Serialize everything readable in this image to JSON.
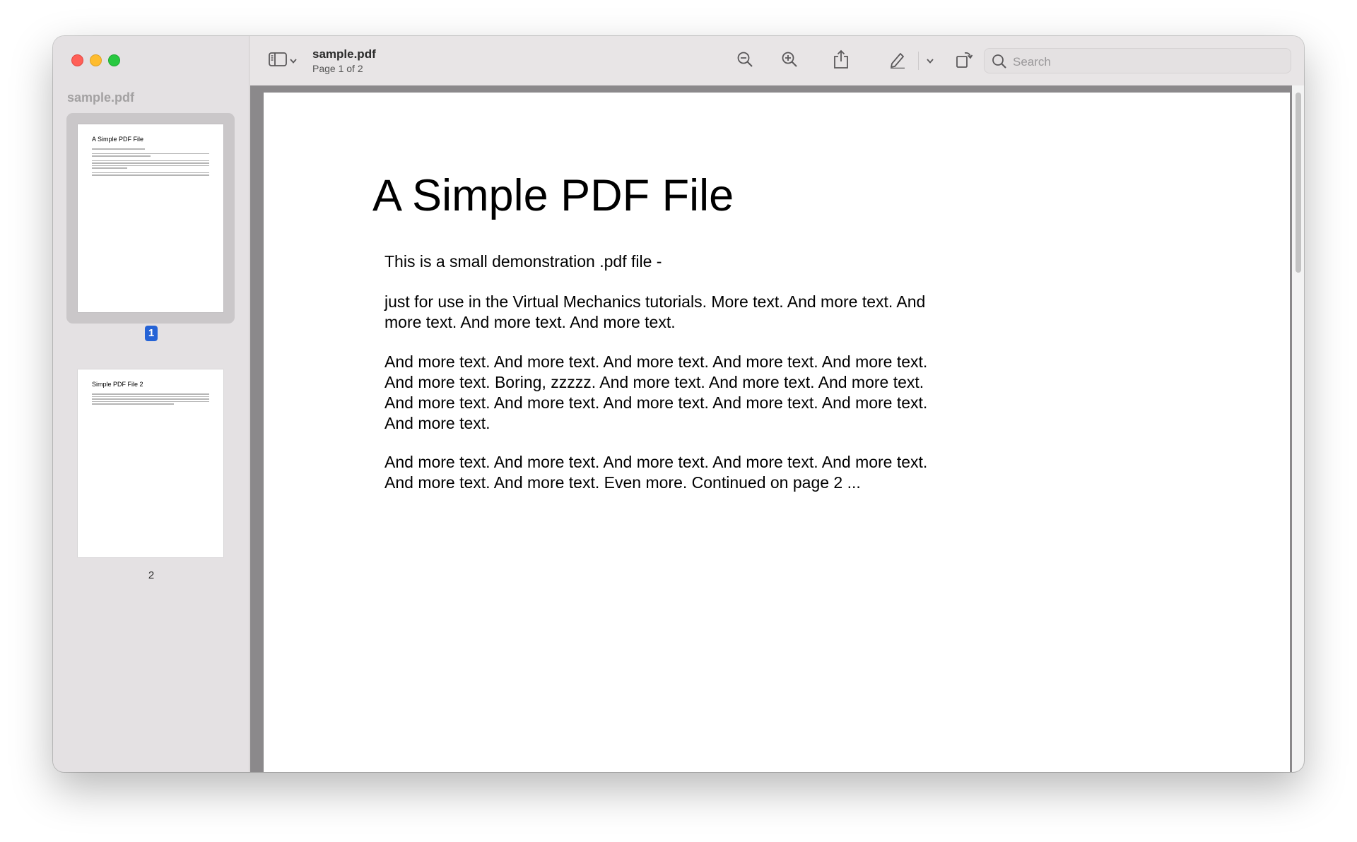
{
  "window": {
    "title": "sample.pdf",
    "subtitle": "Page 1 of 2"
  },
  "sidebar": {
    "title": "sample.pdf",
    "thumbnails": [
      {
        "page_label": "1",
        "heading": "A Simple PDF File",
        "selected": true
      },
      {
        "page_label": "2",
        "heading": "Simple PDF File 2",
        "selected": false
      }
    ]
  },
  "toolbar": {
    "icons": [
      "sidebar-toggle-icon",
      "chevron-down-icon",
      "zoom-out-icon",
      "zoom-in-icon",
      "share-icon",
      "markup-pen-icon",
      "chevron-down-icon",
      "rotate-icon",
      "annotate-icon"
    ],
    "search_placeholder": "Search"
  },
  "document": {
    "title": "A Simple PDF File",
    "paragraphs": [
      "This is a small demonstration .pdf file -",
      "just for use in the Virtual Mechanics tutorials. More text. And more text. And more text. And more text. And more text.",
      "And more text. And more text. And more text. And more text. And more text. And more text. Boring, zzzzz. And more text. And more text. And more text. And more text. And more text. And more text. And more text. And more text. And more text.",
      "And more text. And more text. And more text. And more text. And more text. And more text. And more text. Even more. Continued on page 2 ..."
    ]
  },
  "colors": {
    "accent": "#2563d6",
    "close": "#ff5f57",
    "minimize": "#febc2e",
    "zoom": "#28c840"
  }
}
